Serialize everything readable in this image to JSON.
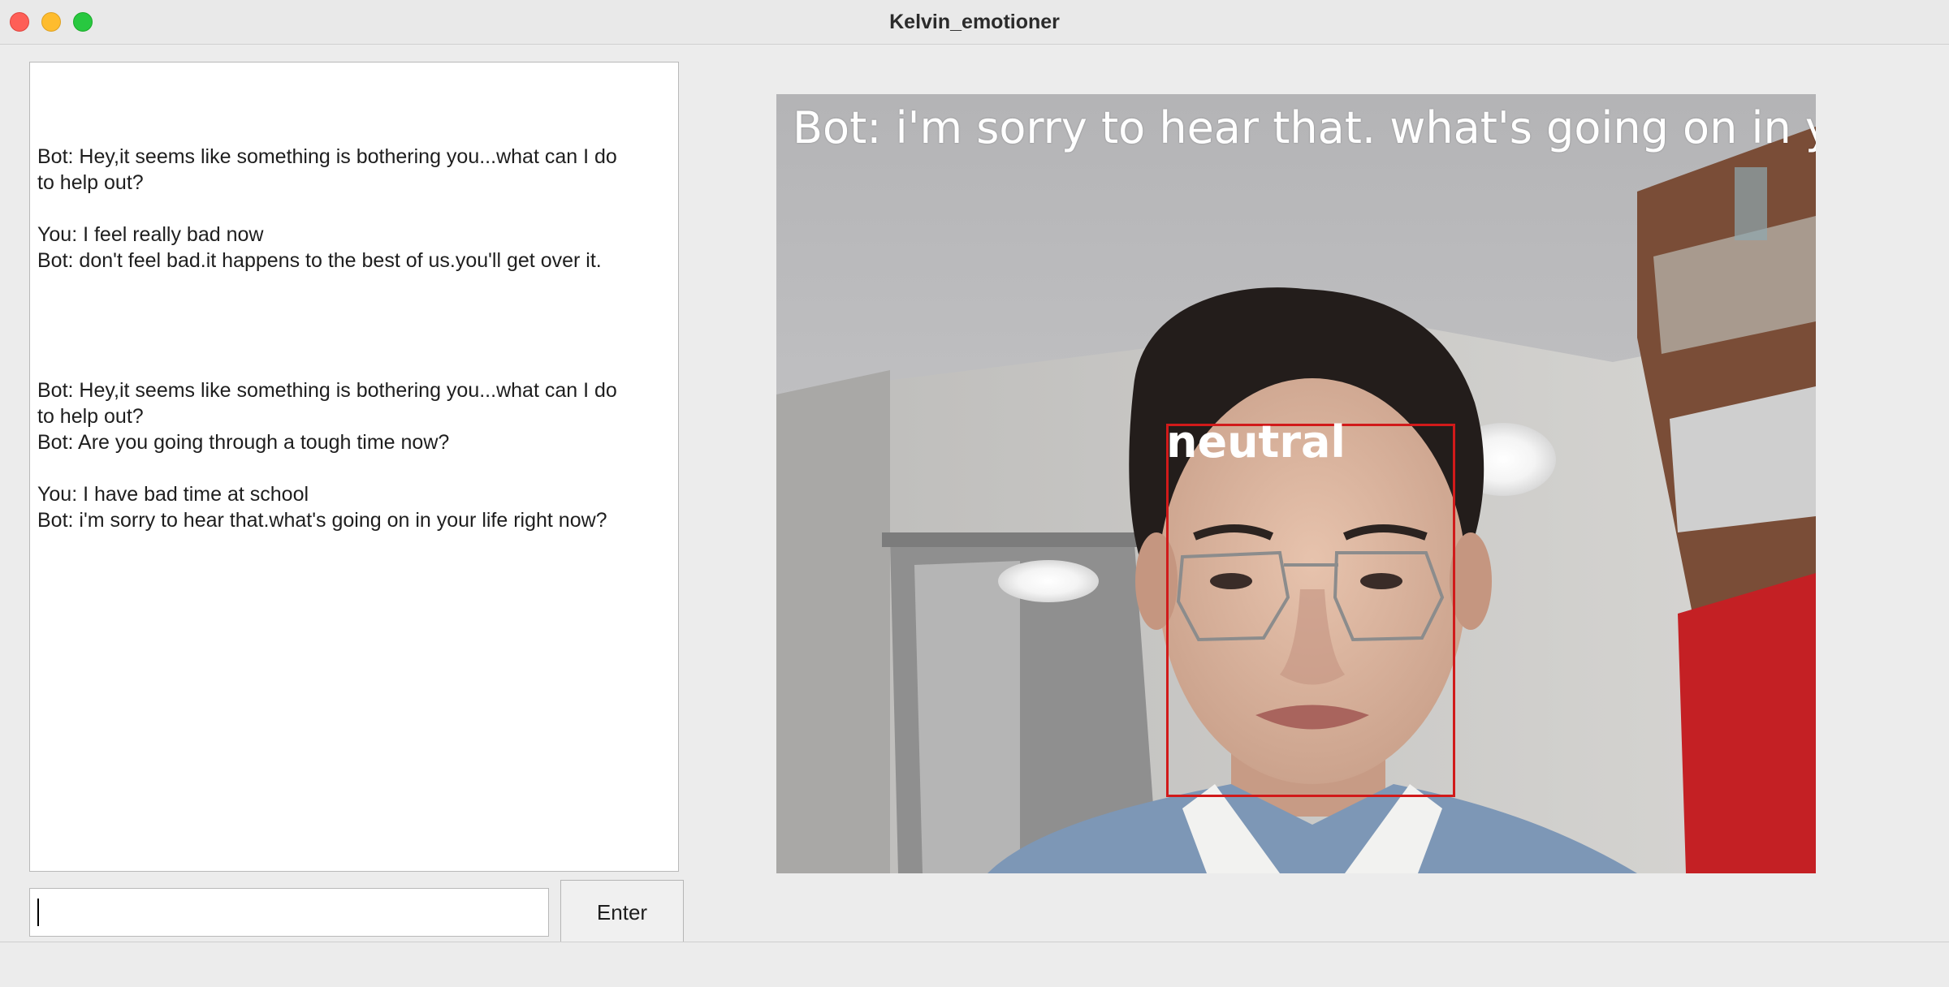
{
  "window": {
    "title": "Kelvin_emotioner"
  },
  "chat": {
    "messages": [
      "Bot: Hey,it seems like something is bothering you...what can I do\nto help out?",
      "You: I feel really bad now\nBot: don't feel bad.it happens to the best of us.you'll get over it.",
      "Bot: Hey,it seems like something is bothering you...what can I do\nto help out?\nBot: Are you going through a tough time now?",
      "You: I have bad time at school\nBot: i'm sorry to hear that.what's going on in your life right now?"
    ]
  },
  "input": {
    "value": "",
    "placeholder": ""
  },
  "enter_button": {
    "label": "Enter"
  },
  "camera": {
    "overlay_text": "Bot: i'm sorry to hear that. what's going on in your life right now?",
    "detection_label": "neutral",
    "box_color": "#d11a1a"
  }
}
